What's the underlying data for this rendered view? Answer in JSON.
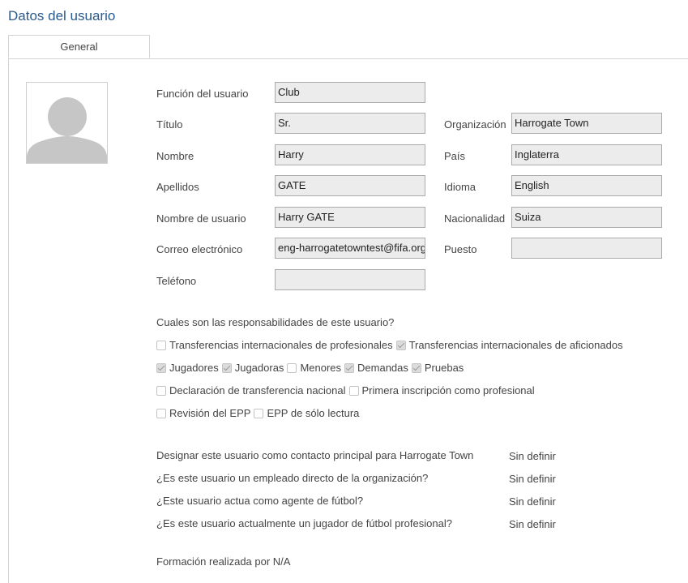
{
  "page": {
    "title": "Datos del usuario"
  },
  "tabs": [
    {
      "label": "General"
    }
  ],
  "form": {
    "funcion": {
      "label": "Función del usuario",
      "value": "Club"
    },
    "titulo": {
      "label": "Título",
      "value": "Sr."
    },
    "nombre": {
      "label": "Nombre",
      "value": "Harry"
    },
    "apellidos": {
      "label": "Apellidos",
      "value": "GATE"
    },
    "usuario": {
      "label": "Nombre de usuario",
      "value": "Harry GATE"
    },
    "correo": {
      "label": "Correo electrónico",
      "value": "eng-harrogatetowntest@fifa.org"
    },
    "telefono": {
      "label": "Teléfono",
      "value": ""
    },
    "organizacion": {
      "label": "Organización",
      "value": "Harrogate Town"
    },
    "pais": {
      "label": "País",
      "value": "Inglaterra"
    },
    "idioma": {
      "label": "Idioma",
      "value": "English"
    },
    "nacionalidad": {
      "label": "Nacionalidad",
      "value": "Suiza"
    },
    "puesto": {
      "label": "Puesto",
      "value": ""
    }
  },
  "responsibilities": {
    "question": "Cuales son las responsabilidades de este usuario?",
    "items": [
      {
        "label": "Transferencias internacionales de profesionales",
        "checked": false
      },
      {
        "label": "Transferencias internacionales de aficionados",
        "checked": true
      },
      {
        "label": "Jugadores",
        "checked": true
      },
      {
        "label": "Jugadoras",
        "checked": true
      },
      {
        "label": "Menores",
        "checked": false
      },
      {
        "label": "Demandas",
        "checked": true
      },
      {
        "label": "Pruebas",
        "checked": true
      },
      {
        "label": "Declaración de transferencia nacional",
        "checked": false
      },
      {
        "label": "Primera inscripción como profesional",
        "checked": false
      },
      {
        "label": "Revisión del EPP",
        "checked": false
      },
      {
        "label": "EPP de sólo lectura",
        "checked": false
      }
    ]
  },
  "questions": [
    {
      "q": "Designar este usuario como contacto principal para Harrogate Town",
      "a": "Sin definir"
    },
    {
      "q": "¿Es este usuario un empleado directo de la organización?",
      "a": "Sin definir"
    },
    {
      "q": "¿Este usuario actua como agente de fútbol?",
      "a": "Sin definir"
    },
    {
      "q": "¿Es este usuario actualmente un jugador de fútbol profesional?",
      "a": "Sin definir"
    }
  ],
  "training": {
    "label": "Formación realizada por N/A"
  },
  "icons": {
    "avatar": "user-silhouette-icon",
    "checkbox": "checkbox-icon"
  },
  "colors": {
    "title": "#2a5a8e",
    "field_bg": "#ececec",
    "field_border": "#aaaaaa"
  }
}
